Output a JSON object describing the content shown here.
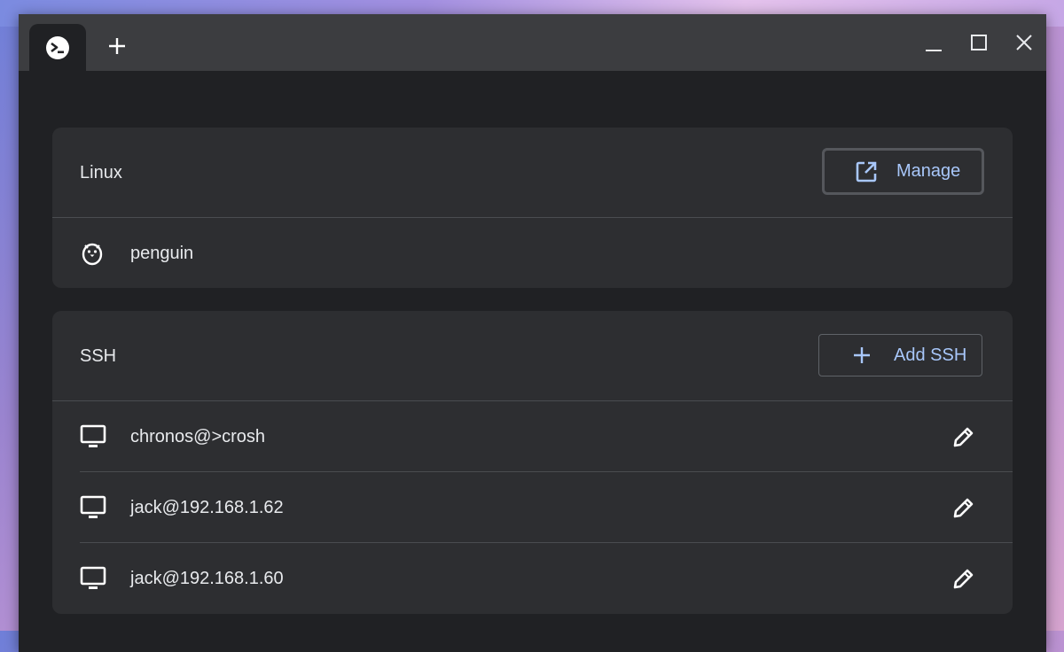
{
  "app": {
    "tabs": [
      {
        "icon": "terminal-icon"
      }
    ],
    "controls": {
      "new_tab": "plus-icon",
      "minimize": "minimize-icon",
      "maximize": "maximize-icon",
      "close": "close-icon"
    }
  },
  "linux": {
    "title": "Linux",
    "manage_label": "Manage",
    "containers": [
      {
        "name": "penguin",
        "icon": "penguin-icon"
      }
    ]
  },
  "ssh": {
    "title": "SSH",
    "add_label": "Add SSH",
    "connections": [
      {
        "name": "chronos@>crosh",
        "icon": "monitor-icon"
      },
      {
        "name": "jack@192.168.1.62",
        "icon": "monitor-icon"
      },
      {
        "name": "jack@192.168.1.60",
        "icon": "monitor-icon"
      }
    ]
  },
  "colors": {
    "accent": "#a8c7fa",
    "card": "#2d2e31",
    "background": "#202124",
    "titlebar": "#3c3d40"
  }
}
